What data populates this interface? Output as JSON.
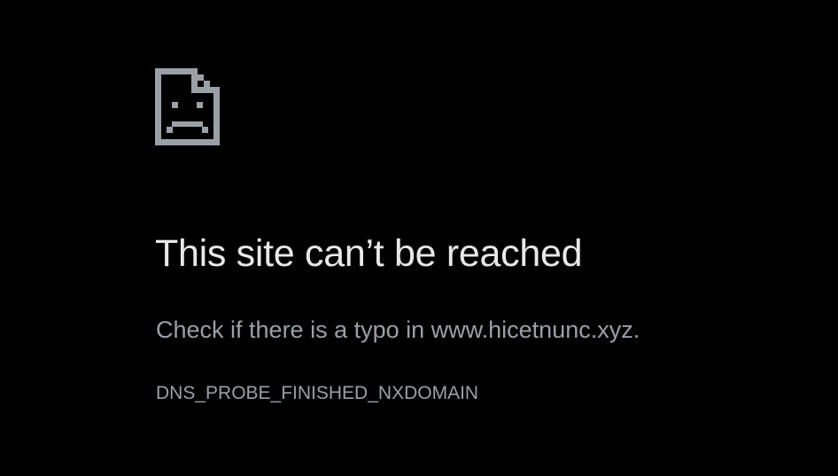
{
  "error_page": {
    "icon": "sad-document-icon",
    "title": "This site can’t be reached",
    "description": "Check if there is a typo in www.hicetnunc.xyz.",
    "error_code": "DNS_PROBE_FINISHED_NXDOMAIN"
  },
  "colors": {
    "background": "#000000",
    "title": "#e8e8e8",
    "body_text": "#9aa0a6",
    "icon": "#9aa0a6"
  }
}
